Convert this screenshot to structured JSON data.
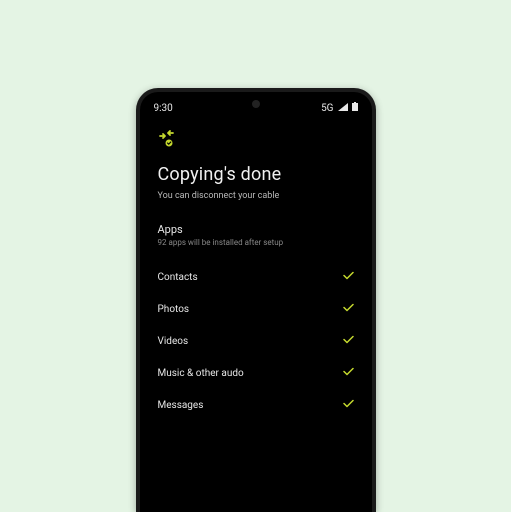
{
  "status": {
    "time": "9:30",
    "network": "5G"
  },
  "header": {
    "title": "Copying's done",
    "subtitle": "You can disconnect your cable"
  },
  "apps_section": {
    "label": "Apps",
    "sub": "92 apps will be installed after setup"
  },
  "items": [
    {
      "label": "Contacts"
    },
    {
      "label": "Photos"
    },
    {
      "label": "Videos"
    },
    {
      "label": "Music & other audo"
    },
    {
      "label": "Messages"
    }
  ]
}
